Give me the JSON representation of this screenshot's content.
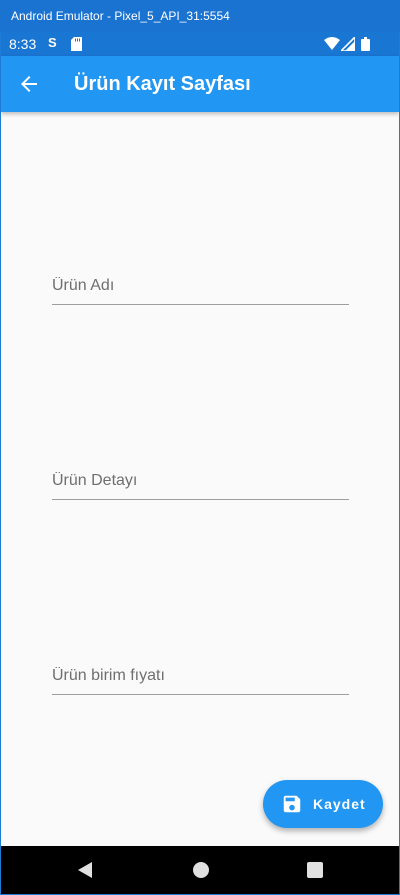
{
  "window": {
    "title": "Android Emulator - Pixel_5_API_31:5554"
  },
  "status_bar": {
    "time": "8:33",
    "notification_icon": "S",
    "icons": [
      "s-notification-icon",
      "sd-card-icon",
      "wifi-icon",
      "cell-signal-icon",
      "battery-icon"
    ]
  },
  "app_bar": {
    "title": "Ürün Kayıt Sayfası",
    "back_icon": "arrow-back-icon"
  },
  "form": {
    "product_name_placeholder": "Ürün Adı",
    "product_name_value": "",
    "product_detail_placeholder": "Ürün Detayı",
    "product_detail_value": "",
    "unit_price_placeholder": "Ürün birim fıyatı",
    "unit_price_value": ""
  },
  "fab": {
    "label": "Kaydet",
    "icon": "save-icon"
  },
  "nav_bar": {
    "icons": [
      "back-triangle-icon",
      "home-circle-icon",
      "recents-square-icon"
    ]
  },
  "colors": {
    "primary": "#2196f3",
    "status_bar": "#1976d2",
    "title_bar": "#1a73d1",
    "background": "#fafafa",
    "underline": "#9e9e9e",
    "nav_bar": "#000000"
  }
}
